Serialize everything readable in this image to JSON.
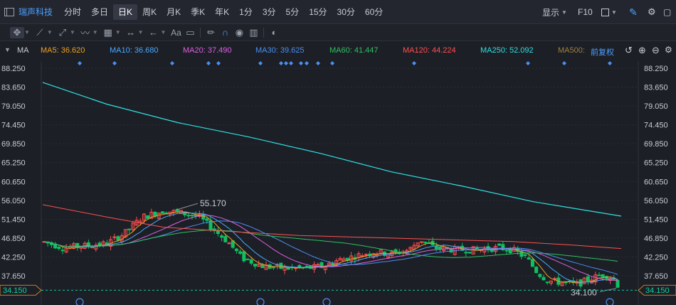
{
  "header": {
    "stock_name": "瑞声科技",
    "periods": [
      "分时",
      "多日",
      "日K",
      "周K",
      "月K",
      "季K",
      "年K",
      "1分",
      "3分",
      "5分",
      "15分",
      "30分",
      "60分"
    ],
    "active_period": "日K",
    "display_label": "显示",
    "f10_label": "F10"
  },
  "ma_bar": {
    "label": "MA",
    "items": [
      {
        "text": "MA5: 36.620",
        "color": "#f0a020"
      },
      {
        "text": "MA10: 36.680",
        "color": "#4aa8ff"
      },
      {
        "text": "MA20: 37.490",
        "color": "#e060e0"
      },
      {
        "text": "MA30: 39.625",
        "color": "#4a8ff0"
      },
      {
        "text": "MA60: 41.447",
        "color": "#30c060"
      },
      {
        "text": "MA120: 44.224",
        "color": "#ff5050"
      },
      {
        "text": "MA250: 52.092",
        "color": "#30e0e0"
      },
      {
        "text": "MA500:",
        "color": "#a08040"
      }
    ],
    "adjust_label": "前复权"
  },
  "toolbar": {
    "font_label": "Aa"
  },
  "chart_data": {
    "type": "candlestick",
    "price_axis_labels": [
      "88.250",
      "83.650",
      "79.050",
      "74.450",
      "69.850",
      "65.250",
      "60.650",
      "56.050",
      "51.450",
      "46.850",
      "42.250",
      "37.650"
    ],
    "ylim": [
      31.2,
      90.4
    ],
    "high_annotation": "55.170",
    "low_annotation": "34.100",
    "current_price": "34.150",
    "colors": {
      "up": "#ff4d4d",
      "down": "#10c060",
      "current": "#0fd1a0",
      "ma250": "#30e0e0",
      "ma120": "#ff5050"
    }
  }
}
